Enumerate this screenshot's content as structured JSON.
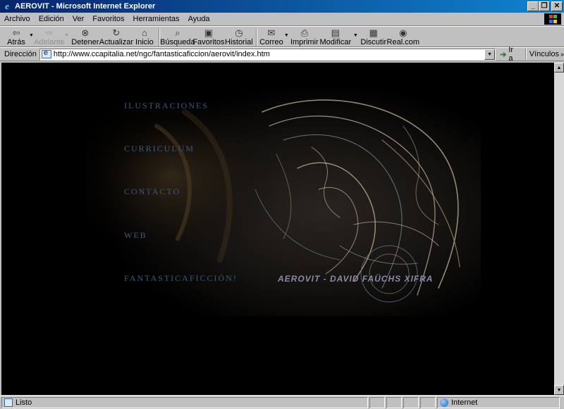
{
  "window": {
    "title": "AEROVIT - Microsoft Internet Explorer"
  },
  "menu": [
    "Archivo",
    "Edición",
    "Ver",
    "Favoritos",
    "Herramientas",
    "Ayuda"
  ],
  "toolbar": {
    "back": "Atrás",
    "forward": "Adelante",
    "stop": "Detener",
    "refresh": "Actualizar",
    "home": "Inicio",
    "search": "Búsqueda",
    "favorites": "Favoritos",
    "history": "Historial",
    "mail": "Correo",
    "print": "Imprimir",
    "edit": "Modificar",
    "discuss": "Discutir",
    "real": "Real.com"
  },
  "address": {
    "label": "Dirección",
    "url": "http://www.ccapitalia.net/ngc/fantasticaficcion/aerovit/index.htm",
    "go": "Ir a",
    "links": "Vínculos"
  },
  "page": {
    "nav": [
      "ILUSTRACIONES",
      "CURRICULUM",
      "CONTACTO",
      "WEB",
      "FANTASTICAFICCIÓN!"
    ],
    "signature": "AEROVIT - DAVID FAÜCHS XIFRA"
  },
  "status": {
    "text": "Listo",
    "zone": "Internet"
  }
}
